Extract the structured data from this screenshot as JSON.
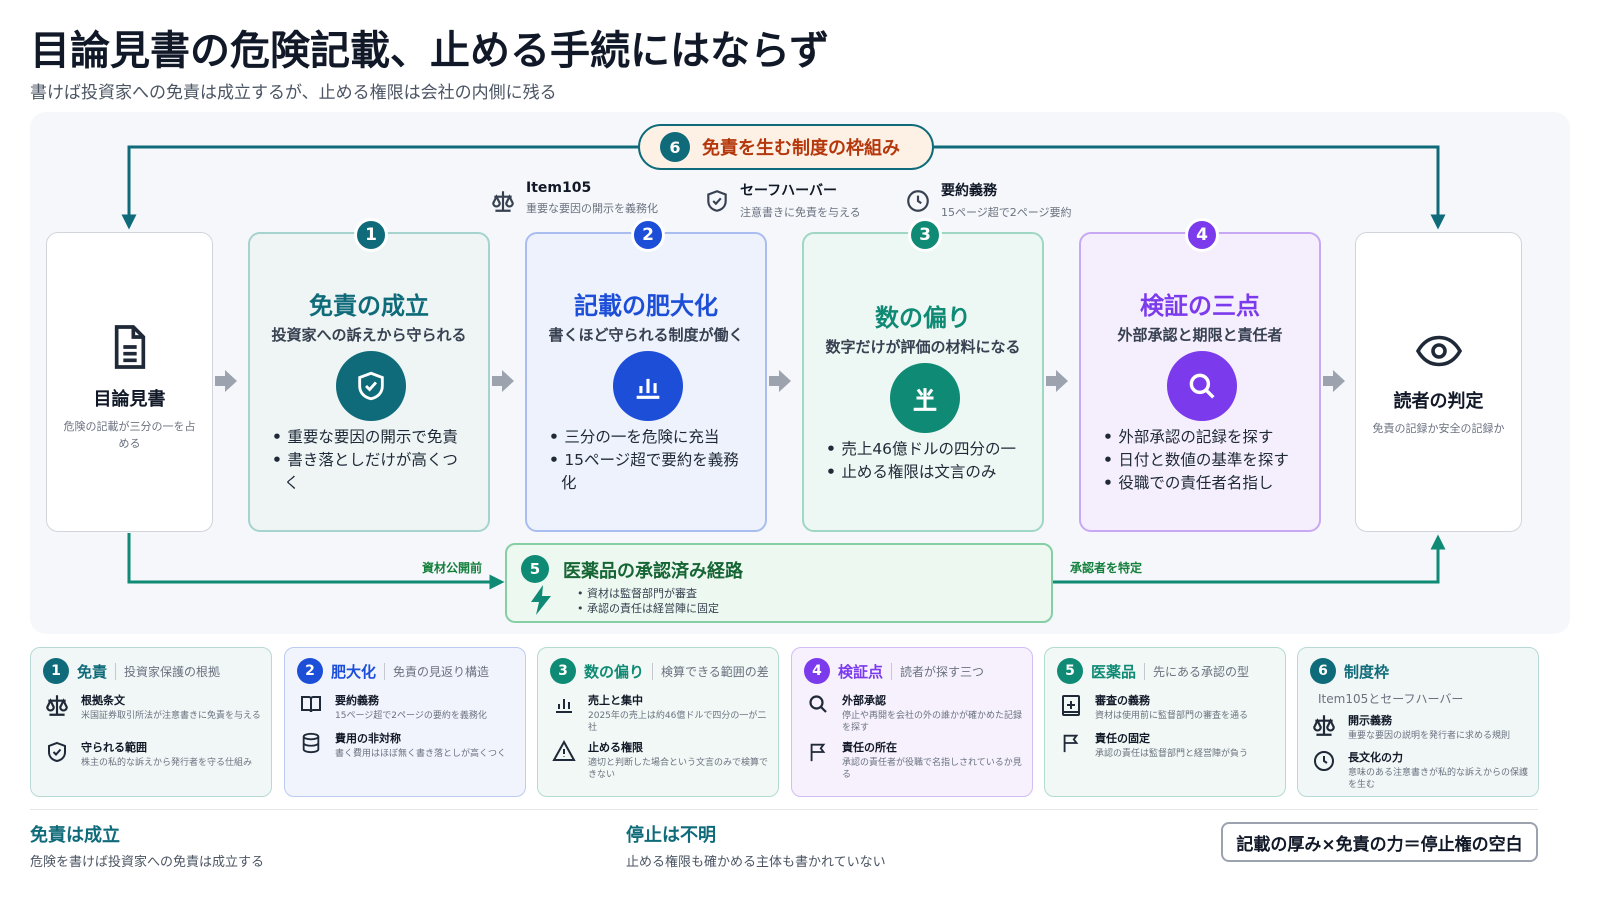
{
  "title": "目論見書の危険記載、止める手続にはならず",
  "subtitle": "書けば投資家への免責は成立するが、止める権限は会社の内側に残る",
  "top_loop": {
    "num": "6",
    "label": "免責を生む制度の枠組み"
  },
  "frameworks": [
    {
      "icon": "scale-icon",
      "title": "Item105",
      "sub": "重要な要因の開示を義務化"
    },
    {
      "icon": "shield-icon",
      "title": "セーフハーバー",
      "sub": "注意書きに免責を与える"
    },
    {
      "icon": "clock-icon",
      "title": "要約義務",
      "sub": "15ページ超で2ページ要約"
    }
  ],
  "start": {
    "icon": "document-icon",
    "title": "目論見書",
    "sub": "危険の記載が三分の一を占める"
  },
  "end": {
    "icon": "eye-icon",
    "title": "読者の判定",
    "sub": "免責の記録か安全の記録か"
  },
  "steps": [
    {
      "num": "1",
      "title": "免責の成立",
      "sub": "投資家への訴えから守られる",
      "icon": "shield-check-icon",
      "color": "#0f6b7a",
      "bullets": [
        "重要な要因の開示で免責",
        "書き落としだけが高くつく"
      ]
    },
    {
      "num": "2",
      "title": "記載の肥大化",
      "sub": "書くほど守られる制度が働く",
      "icon": "bar-chart-icon",
      "color": "#1d4ed8",
      "bullets": [
        "三分の一を危険に充当",
        "15ページ超で要約を義務化"
      ]
    },
    {
      "num": "3",
      "title": "数の偏り",
      "sub": "数字だけが評価の材料になる",
      "icon": "sigma-icon",
      "color": "#0f8a74",
      "bullets": [
        "売上46億ドルの四分の一",
        "止める権限は文言のみ"
      ]
    },
    {
      "num": "4",
      "title": "検証の三点",
      "sub": "外部承認と期限と責任者",
      "icon": "search-icon",
      "color": "#7c3aed",
      "bullets": [
        "外部承認の記録を探す",
        "日付と数値の基準を探す",
        "役職での責任者名指し"
      ]
    }
  ],
  "step5": {
    "num": "5",
    "title": "医薬品の承認済み経路",
    "bullets": [
      "資材は監督部門が審査",
      "承認の責任は経営陣に固定"
    ],
    "in_label": "資材公開前",
    "out_label": "承認者を特定"
  },
  "cards": [
    {
      "num": "1",
      "title": "免責",
      "sub": "投資家保護の根拠",
      "color": "#0f6b7a",
      "rows": [
        {
          "icon": "scale-icon",
          "title": "根拠条文",
          "text": "米国証券取引所法が注意書きに免責を与える"
        },
        {
          "icon": "shield-icon",
          "title": "守られる範囲",
          "text": "株主の私的な訴えから発行者を守る仕組み"
        }
      ]
    },
    {
      "num": "2",
      "title": "肥大化",
      "sub": "免責の見返り構造",
      "color": "#1d4ed8",
      "rows": [
        {
          "icon": "book-icon",
          "title": "要約義務",
          "text": "15ページ超で2ページの要約を義務化"
        },
        {
          "icon": "database-icon",
          "title": "費用の非対称",
          "text": "書く費用はほぼ無く書き落としが高くつく"
        }
      ]
    },
    {
      "num": "3",
      "title": "数の偏り",
      "sub": "検算できる範囲の差",
      "color": "#0f8a74",
      "rows": [
        {
          "icon": "bar-chart-icon",
          "title": "売上と集中",
          "text": "2025年の売上は約46億ドルで四分の一が二社"
        },
        {
          "icon": "warning-icon",
          "title": "止める権限",
          "text": "適切と判断した場合という文言のみで検算できない"
        }
      ]
    },
    {
      "num": "4",
      "title": "検証点",
      "sub": "読者が探す三つ",
      "color": "#7c3aed",
      "rows": [
        {
          "icon": "search-icon",
          "title": "外部承認",
          "text": "停止や再開を会社の外の誰かが確かめた記録を探す"
        },
        {
          "icon": "flag-icon",
          "title": "責任の所在",
          "text": "承認の責任者が役職で名指しされているか見る"
        }
      ]
    },
    {
      "num": "5",
      "title": "医薬品",
      "sub": "先にある承認の型",
      "color": "#0f8a74",
      "rows": [
        {
          "icon": "plus-box-icon",
          "title": "審査の義務",
          "text": "資材は使用前に監督部門の審査を通る"
        },
        {
          "icon": "flag-icon",
          "title": "責任の固定",
          "text": "承認の責任は監督部門と経営陣が負う"
        }
      ]
    },
    {
      "num": "6",
      "title": "制度枠",
      "sub": "Item105とセーフハーバー",
      "color": "#0f6b7a",
      "rows": [
        {
          "icon": "scale-icon",
          "title": "開示義務",
          "text": "重要な要因の説明を発行者に求める規則"
        },
        {
          "icon": "clock-icon",
          "title": "長文化の力",
          "text": "意味のある注意書きが私的な訴えからの保護を生む"
        }
      ]
    }
  ],
  "footer": {
    "left_title": "免責は成立",
    "left_sub": "危険を書けば投資家への免責は成立する",
    "mid_title": "停止は不明",
    "mid_sub": "止める権限も確かめる主体も書かれていない",
    "equation": "記載の厚み×免責の力＝停止権の空白"
  }
}
